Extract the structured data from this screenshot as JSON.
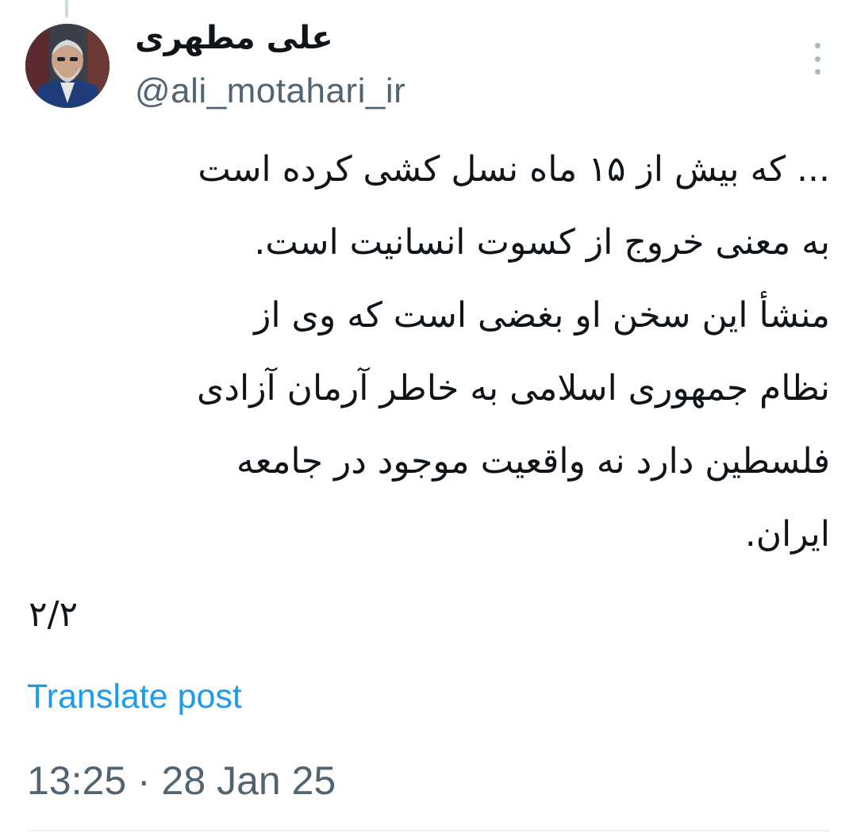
{
  "author": {
    "display_name": "علی مطهری",
    "handle": "@ali_motahari_ir",
    "avatar_icon": "profile-photo"
  },
  "more_icon": "more-vertical-icon",
  "tweet": {
    "lines": [
      "... که بیش از ۱۵ ماه نسل کشی کرده است",
      "به معنی خروج از کسوت انسانیت است.",
      "منشأ این سخن او بغضی است که وی از",
      "نظام جمهوری اسلامی به خاطر آرمان آزادی",
      "فلسطین دارد نه واقعیت موجود در جامعه",
      "ایران."
    ],
    "thread_counter": "۲/۲"
  },
  "translate_label": "Translate post",
  "timestamp": "13:25 · 28 Jan 25",
  "colors": {
    "link": "#1d9bf0",
    "secondary_text": "#536471",
    "primary_text": "#0f1419"
  }
}
